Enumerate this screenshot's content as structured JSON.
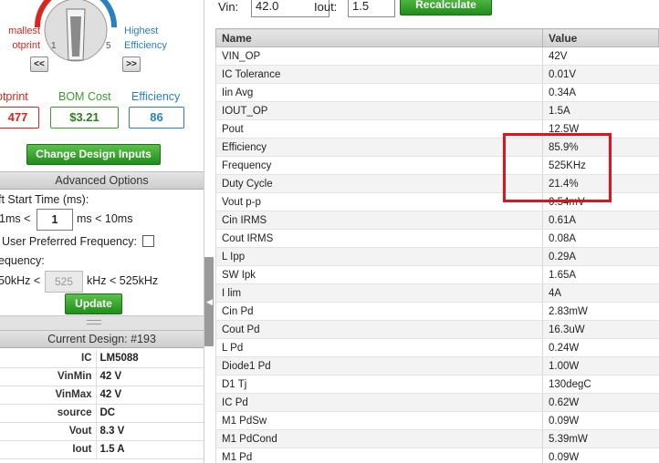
{
  "selector": {
    "left_label": "mallest\notprint",
    "right_label": "Highest\nEfficiency",
    "tick_min": "1",
    "tick_max": "5",
    "prev_label": "<<",
    "next_label": ">>"
  },
  "metrics": {
    "footprint": {
      "label": "otprint",
      "value": "477"
    },
    "bom": {
      "label": "BOM Cost",
      "value": "$3.21"
    },
    "efficiency": {
      "label": "Efficiency",
      "value": "86"
    }
  },
  "buttons": {
    "change": "Change Design Inputs",
    "update": "Update",
    "recalculate": "Recalculate"
  },
  "advanced": {
    "header": "Advanced Options",
    "soft_start_label": "ft Start Time (ms):",
    "soft_start_lo": "1ms <",
    "soft_start_value": "1",
    "soft_start_hi": "ms < 10ms",
    "preferred_freq_label": "User Preferred Frequency:",
    "frequency_label": "equency:",
    "freq_lo": "50kHz <",
    "freq_value": "525",
    "freq_hi": "kHz < 525kHz"
  },
  "current_design": {
    "header": "Current Design: #193",
    "rows": [
      {
        "key": "IC",
        "value": "LM5088"
      },
      {
        "key": "VinMin",
        "value": "42 V"
      },
      {
        "key": "VinMax",
        "value": "42 V"
      },
      {
        "key": "source",
        "value": "DC"
      },
      {
        "key": "Vout",
        "value": "8.3 V"
      },
      {
        "key": "Iout",
        "value": "1.5 A"
      }
    ]
  },
  "inputs": {
    "vin_label": "Vin:",
    "vin_value": "42.0",
    "iout_label": "Iout:",
    "iout_value": "1.5"
  },
  "results": {
    "columns": [
      "Name",
      "Value"
    ],
    "rows": [
      [
        "VIN_OP",
        "42V"
      ],
      [
        "IC Tolerance",
        "0.01V"
      ],
      [
        "Iin Avg",
        "0.34A"
      ],
      [
        "IOUT_OP",
        "1.5A"
      ],
      [
        "Pout",
        "12.5W"
      ],
      [
        "Efficiency",
        "85.9%"
      ],
      [
        "Frequency",
        "525KHz"
      ],
      [
        "Duty Cycle",
        "21.4%"
      ],
      [
        "Vout p-p",
        "0.54mV"
      ],
      [
        "Cin IRMS",
        "0.61A"
      ],
      [
        "Cout IRMS",
        "0.08A"
      ],
      [
        "L Ipp",
        "0.29A"
      ],
      [
        "SW Ipk",
        "1.65A"
      ],
      [
        "I lim",
        "4A"
      ],
      [
        "Cin Pd",
        "2.83mW"
      ],
      [
        "Cout Pd",
        "16.3uW"
      ],
      [
        "L Pd",
        "0.24W"
      ],
      [
        "Diode1 Pd",
        "1.00W"
      ],
      [
        "D1 Tj",
        "130degC"
      ],
      [
        "IC Pd",
        "0.62W"
      ],
      [
        "M1 PdSw",
        "0.09W"
      ],
      [
        "M1 PdCond",
        "5.39mW"
      ],
      [
        "M1 Pd",
        "0.09W"
      ]
    ]
  },
  "colors": {
    "footprint": "#d9261c",
    "bom": "#3b9b2d",
    "efficiency": "#2a7fc0",
    "highlight": "#e0121e"
  }
}
